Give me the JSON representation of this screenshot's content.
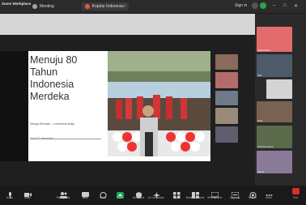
{
  "app": {
    "name": "Zoom Workplace"
  },
  "tabs": [
    {
      "label": "Meeting"
    },
    {
      "label": "Kopdar Indonesia Merdeka"
    }
  ],
  "titlebar": {
    "signin": "Sign in"
  },
  "slide": {
    "title_lines": [
      "Menuju 80",
      "Tahun",
      "Indonesia",
      "Merdeka"
    ],
    "subtitle": "Warga Bersatu – Indonesia Maju",
    "author": "Iorrel T. Iskandar"
  },
  "participants": [
    {
      "name": "Syaiful Bahri"
    },
    {
      "name": "Rika"
    },
    {
      "name": "Eddy"
    },
    {
      "name": "Gibrahan Rieza"
    },
    {
      "name": "Nanda"
    }
  ],
  "toolbar": {
    "items": [
      {
        "label": "Audio",
        "icon": "microphone-icon"
      },
      {
        "label": "Video",
        "icon": "video-camera-icon"
      },
      {
        "label": "Participants",
        "icon": "participants-icon"
      },
      {
        "label": "Chat",
        "icon": "chat-icon"
      },
      {
        "label": "React",
        "icon": "react-icon"
      },
      {
        "label": "Share",
        "icon": "share-screen-icon"
      },
      {
        "label": "Host tools",
        "icon": "shield-icon"
      },
      {
        "label": "AI Companion",
        "icon": "ai-companion-icon"
      },
      {
        "label": "Apps",
        "icon": "apps-icon"
      },
      {
        "label": "Breakout rooms",
        "icon": "breakout-rooms-icon"
      },
      {
        "label": "Whiteboards",
        "icon": "whiteboard-icon"
      },
      {
        "label": "Captions",
        "icon": "captions-icon"
      },
      {
        "label": "Record",
        "icon": "record-icon"
      },
      {
        "label": "More",
        "icon": "more-icon"
      }
    ],
    "end_label": "End"
  },
  "colors": {
    "accent_red": "#d93025",
    "share_green": "#1aaa55"
  }
}
